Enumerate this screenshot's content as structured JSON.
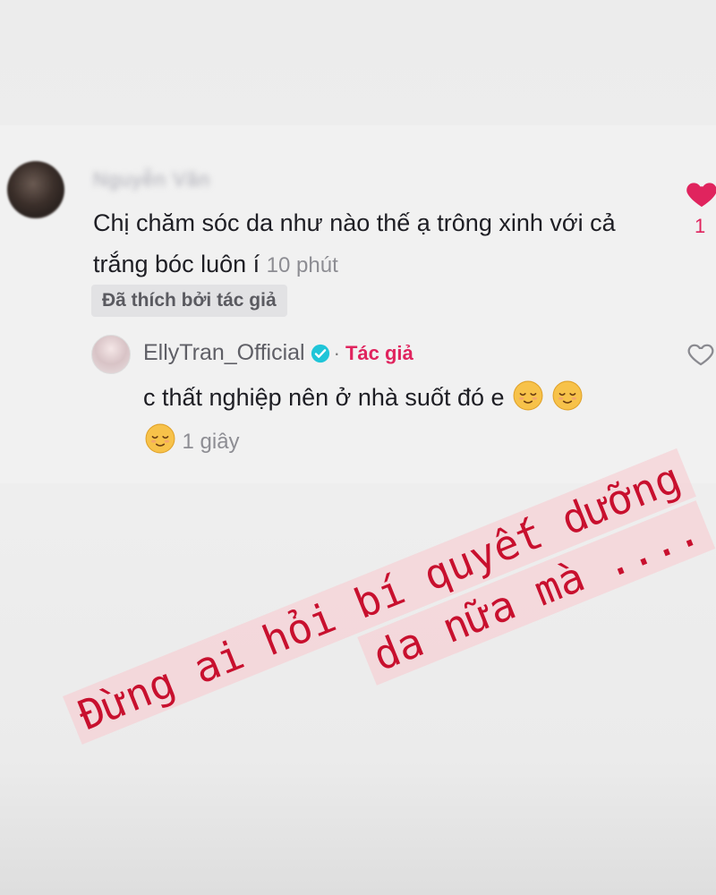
{
  "comment": {
    "username": "Nguyễn Văn",
    "text": "Chị chăm sóc da như nào thế ạ trông xinh với cả trắng bóc luôn í",
    "timestamp": "10 phút",
    "liked_badge": "Đã thích bởi tác giả",
    "like_count": "1"
  },
  "reply": {
    "username": "EllyTran_Official",
    "separator": "·",
    "author_tag": "Tác giả",
    "text": "c thất nghiệp nên ở nhà suốt đó e",
    "timestamp": "1 giây",
    "emoji": "relieved-face"
  },
  "sticker": {
    "line1": "Đừng ai hỏi bí quyết dưỡng",
    "line2": "da nữa mà ...."
  },
  "colors": {
    "accent": "#e0245e",
    "sticker_text": "#c8102e",
    "sticker_highlight": "#f6d2d6",
    "background": "#ececec"
  }
}
